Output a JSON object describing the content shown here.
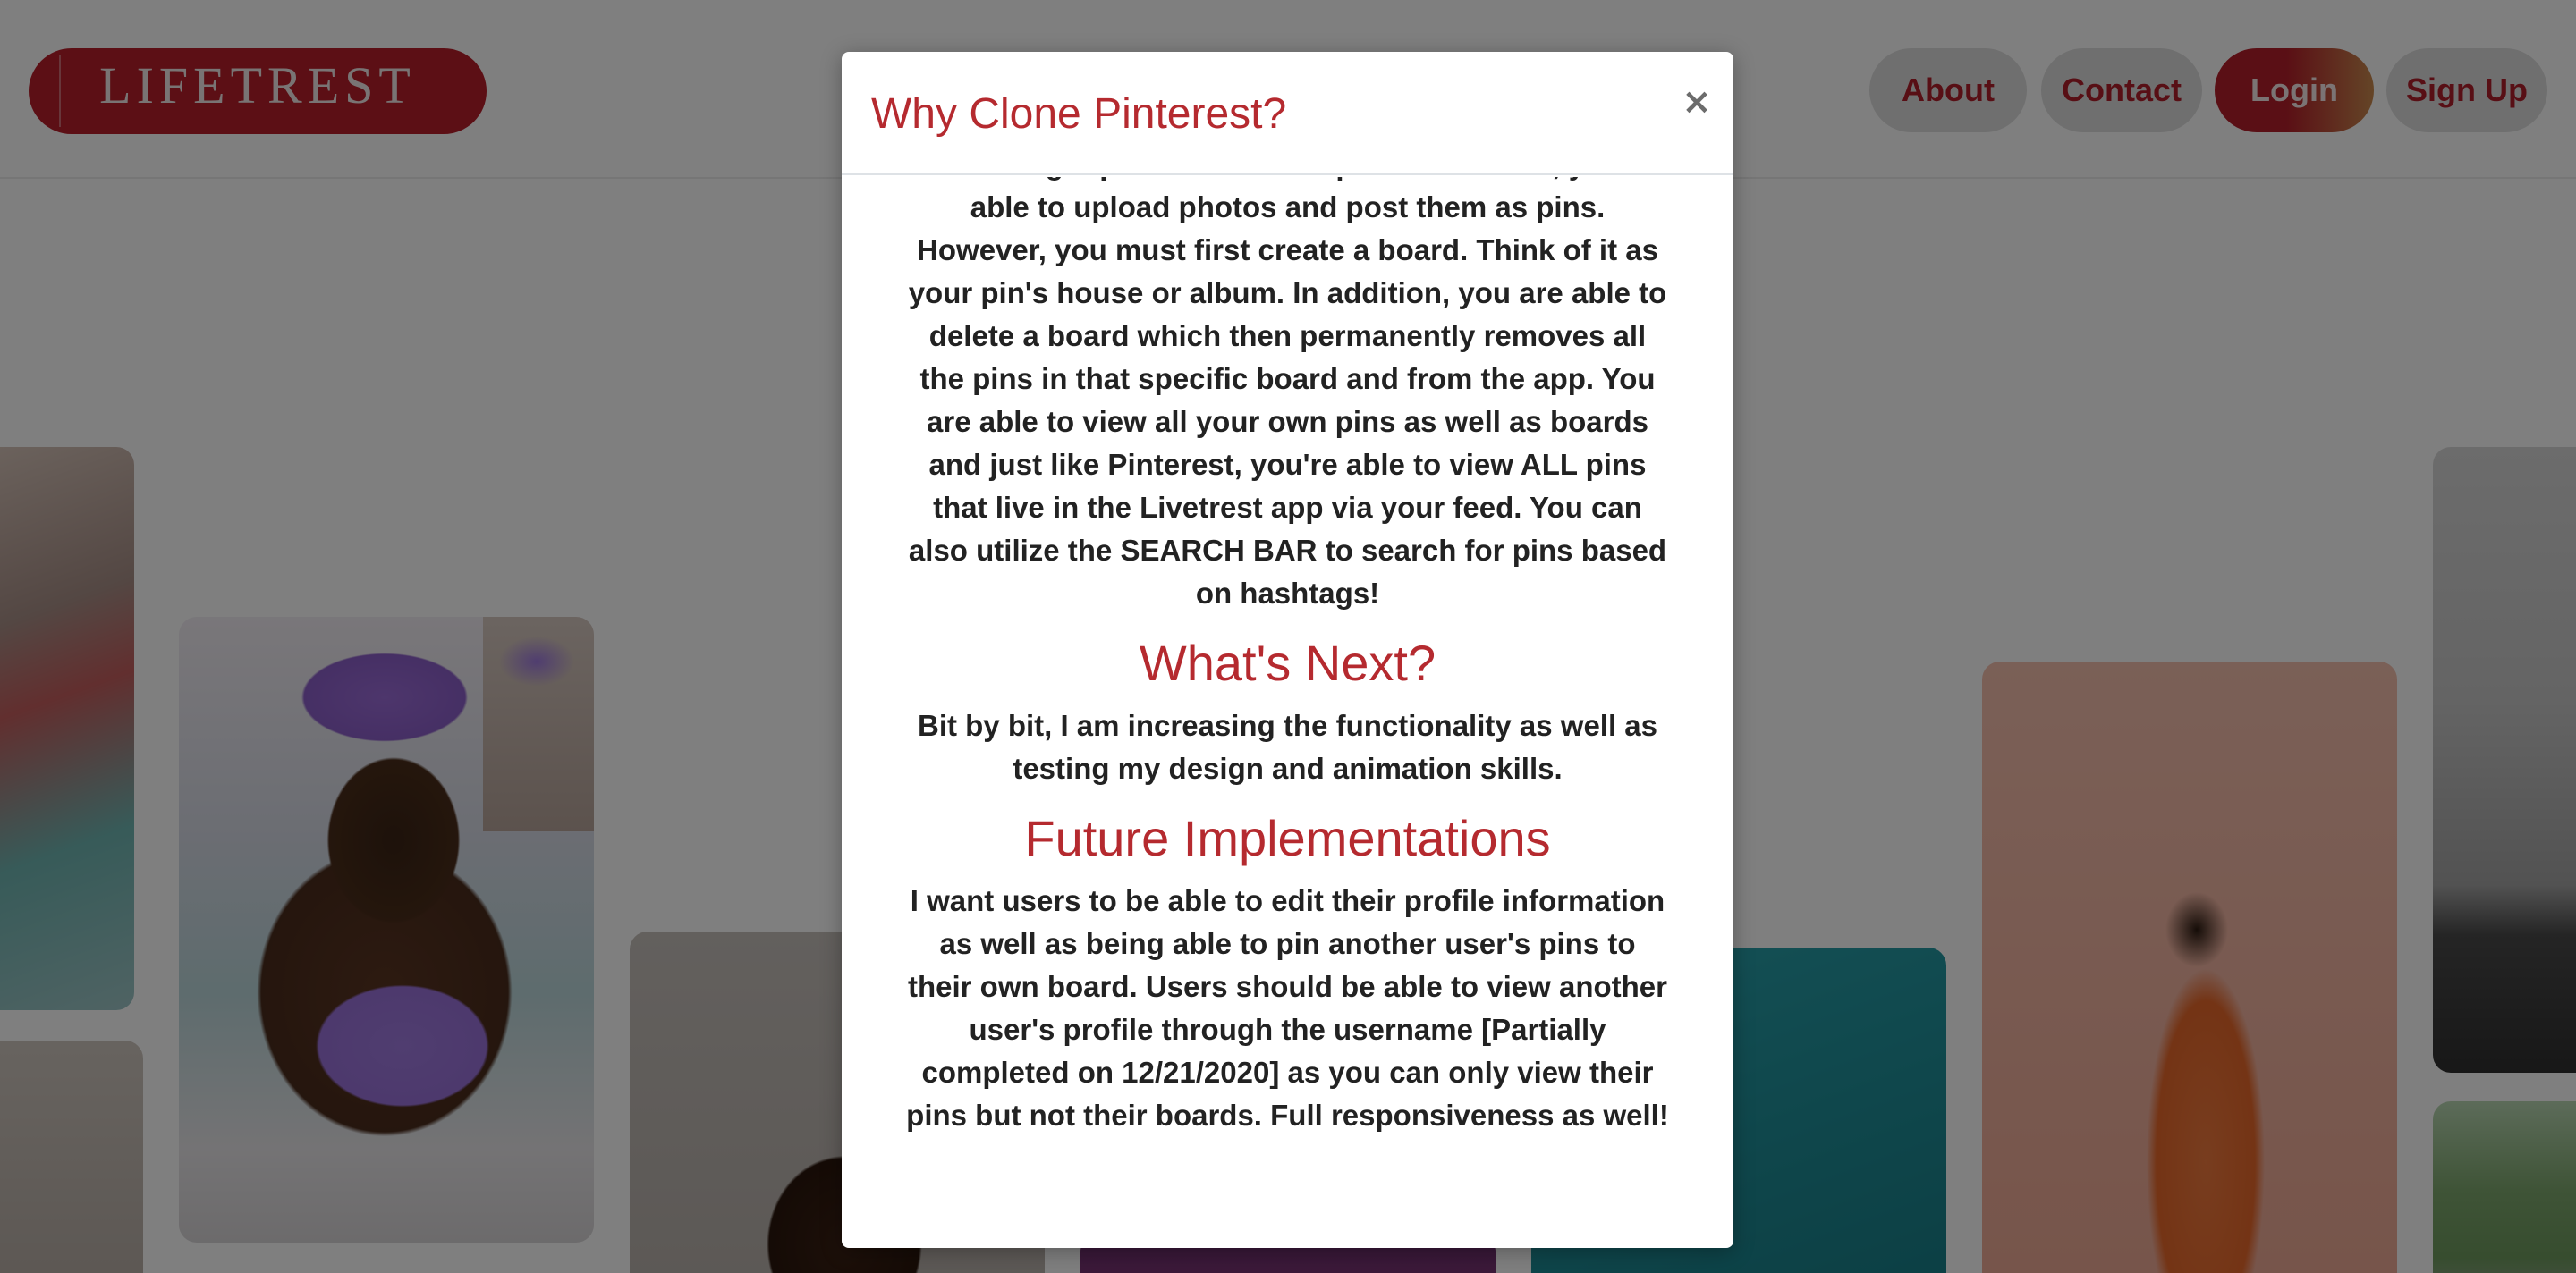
{
  "navbar": {
    "logo_text": "LIFETREST",
    "links": {
      "about": "About",
      "contact": "Contact",
      "login": "Login",
      "signup": "Sign Up"
    }
  },
  "modal": {
    "title": "Why Clone Pinterest?",
    "close_label": "×",
    "intro_paragraph": "via the signup modal. Once a part of Lifetrest, you're able to upload photos and post them as pins. However, you must first create a board. Think of it as your pin's house or album. In addition, you are able to delete a board which then permanently removes all the pins in that specific board and from the app. You are able to view all your own pins as well as boards and just like Pinterest, you're able to view ALL pins that live in the Livetrest app via your feed. You can also utilize the SEARCH BAR to search for pins based on hashtags!",
    "sections": [
      {
        "heading": "What's Next?",
        "text": "Bit by bit, I am increasing the functionality as well as testing my design and animation skills."
      },
      {
        "heading": "Future Implementations",
        "text": "I want users to be able to edit their profile information as well as being able to pin another user's pins to their own board. Users should be able to view another user's profile through the username [Partially completed on 12/21/2020] as you can only view their pins but not their boards. Full responsiveness as well!"
      }
    ]
  },
  "colors": {
    "brand": "#b81f2b",
    "heading": "#b52a2f",
    "backdrop": "rgba(0,0,0,0.5)"
  }
}
